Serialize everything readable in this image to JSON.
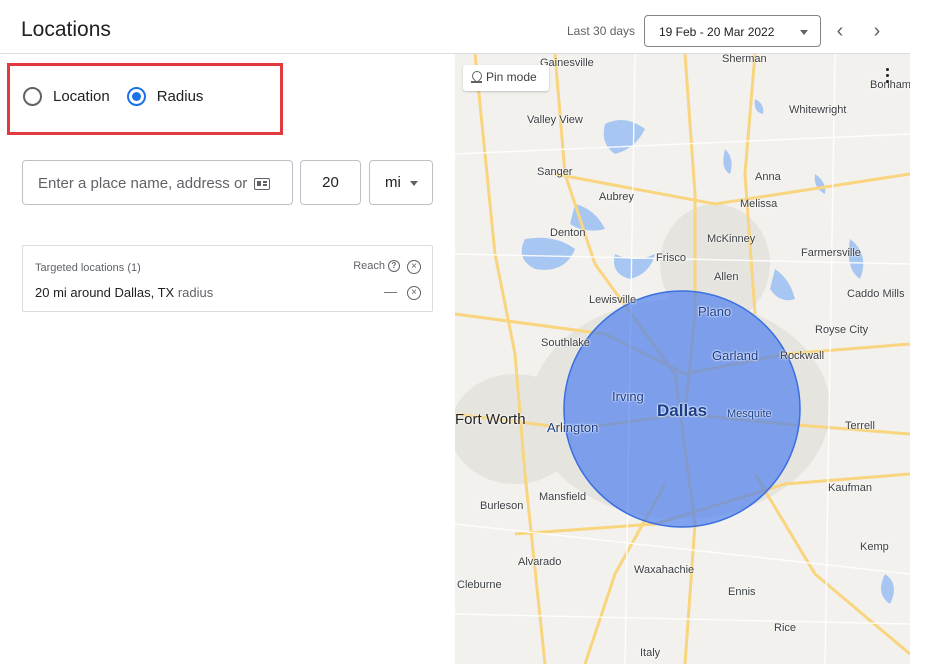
{
  "header": {
    "title": "Locations",
    "range_label": "Last 30 days",
    "date_range": "19 Feb - 20 Mar 2022",
    "prev_icon": "chevron-left-icon",
    "next_icon": "chevron-right-icon"
  },
  "targeting_mode": {
    "options": [
      {
        "label": "Location",
        "checked": false
      },
      {
        "label": "Radius",
        "checked": true
      }
    ],
    "highlight_color": "#e03a3e",
    "accent_color": "#1a73e8"
  },
  "radius_form": {
    "place_placeholder": "Enter a place name, address or",
    "place_icon": "contact-card-icon",
    "radius_value": "20",
    "unit": "mi"
  },
  "targeted_locations": {
    "header": "Targeted locations (1)",
    "reach_label": "Reach",
    "rows": [
      {
        "text": "20 mi around Dallas, TX",
        "suffix": "radius",
        "reach": "—"
      }
    ]
  },
  "map": {
    "pin_mode_label": "Pin mode",
    "radius_circle_color": "#4a7ef0",
    "labels": {
      "gainesville": "Gainesville",
      "sherman": "Sherman",
      "bonham": "Bonham",
      "valley_view": "Valley View",
      "whitewright": "Whitewright",
      "sanger": "Sanger",
      "aubrey": "Aubrey",
      "anna": "Anna",
      "melissa": "Melissa",
      "denton": "Denton",
      "mckinney": "McKinney",
      "frisco": "Frisco",
      "farmersville": "Farmersville",
      "allen": "Allen",
      "caddo_mills": "Caddo Mills",
      "lewisville": "Lewisville",
      "plano": "Plano",
      "royse_city": "Royse City",
      "southlake": "Southlake",
      "garland": "Garland",
      "rockwall": "Rockwall",
      "irving": "Irving",
      "dallas": "Dallas",
      "mesquite": "Mesquite",
      "fort_worth": "Fort Worth",
      "arlington": "Arlington",
      "terrell": "Terrell",
      "kaufman": "Kaufman",
      "burleson": "Burleson",
      "mansfield": "Mansfield",
      "kemp": "Kemp",
      "alvarado": "Alvarado",
      "waxahachie": "Waxahachie",
      "cleburne": "Cleburne",
      "ennis": "Ennis",
      "rice": "Rice",
      "italy": "Italy"
    }
  }
}
